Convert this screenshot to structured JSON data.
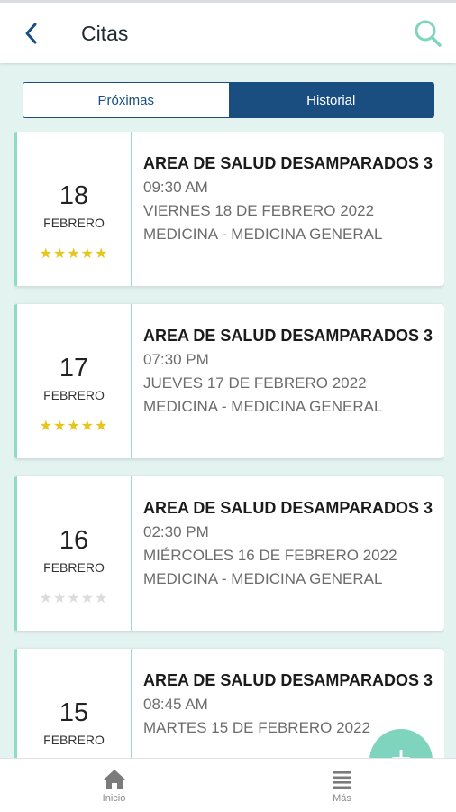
{
  "header": {
    "title": "Citas"
  },
  "tabs": [
    {
      "label": "Próximas"
    },
    {
      "label": "Historial"
    }
  ],
  "appointments": [
    {
      "day": "18",
      "month": "FEBRERO",
      "rating": 5,
      "clinic": "AREA DE SALUD DESAMPARADOS 3",
      "time": "09:30 AM",
      "date": "VIERNES 18 DE FEBRERO 2022",
      "service": "MEDICINA - MEDICINA GENERAL"
    },
    {
      "day": "17",
      "month": "FEBRERO",
      "rating": 5,
      "clinic": "AREA DE SALUD DESAMPARADOS 3",
      "time": "07:30 PM",
      "date": "JUEVES 17 DE FEBRERO 2022",
      "service": "MEDICINA - MEDICINA GENERAL"
    },
    {
      "day": "16",
      "month": "FEBRERO",
      "rating": 0,
      "clinic": "AREA DE SALUD DESAMPARADOS 3",
      "time": "02:30 PM",
      "date": "MIÉRCOLES 16 DE FEBRERO 2022",
      "service": "MEDICINA - MEDICINA GENERAL"
    },
    {
      "day": "15",
      "month": "FEBRERO",
      "rating": 0,
      "clinic": "AREA DE SALUD DESAMPARADOS 3",
      "time": "08:45 AM",
      "date": "MARTES 15 DE FEBRERO 2022",
      "service": ""
    }
  ],
  "fab": {
    "symbol": "+"
  },
  "nav": [
    {
      "label": "Inicio",
      "icon": "home-icon"
    },
    {
      "label": "Más",
      "icon": "menu-icon"
    }
  ],
  "colors": {
    "primary": "#1a4e80",
    "accent": "#7fd4bd",
    "star": "#e6c61c",
    "background": "#e3f3ef"
  }
}
